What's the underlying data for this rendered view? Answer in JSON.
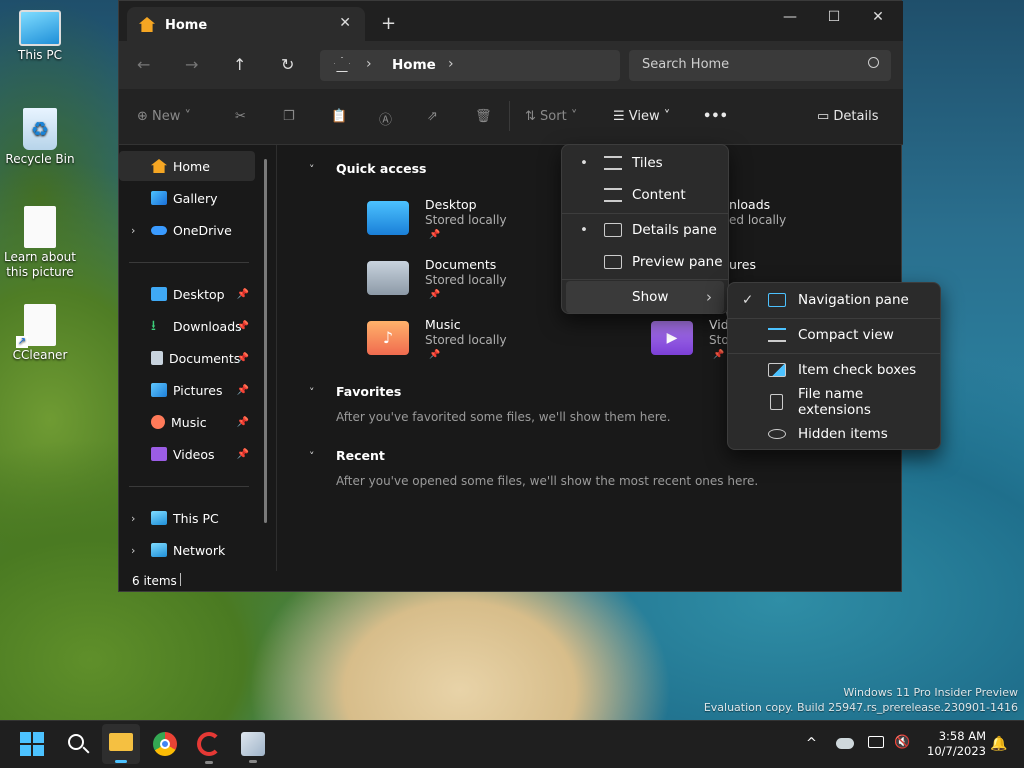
{
  "desktop": {
    "icons": [
      {
        "label": "This PC"
      },
      {
        "label": "Recycle Bin"
      },
      {
        "label": "Learn about this picture"
      },
      {
        "label": "CCleaner"
      }
    ],
    "watermark_line1": "Windows 11 Pro Insider Preview",
    "watermark_line2": "Evaluation copy. Build 25947.rs_prerelease.230901-1416"
  },
  "window": {
    "tab_title": "Home",
    "new_tab_symbol": "+",
    "caption": {
      "minimize": "—",
      "maximize": "☐",
      "close": "✕"
    },
    "address": {
      "breadcrumb": "Home",
      "search_placeholder": "Search Home"
    },
    "toolbar": {
      "new_label": "New",
      "sort_label": "Sort",
      "view_label": "View",
      "more_label": "•••",
      "details_label": "Details"
    },
    "sidebar": {
      "top": [
        {
          "label": "Home",
          "icon": "home-icon"
        },
        {
          "label": "Gallery",
          "icon": "gallery-icon"
        },
        {
          "label": "OneDrive",
          "icon": "onedrive-icon"
        }
      ],
      "pinned": [
        {
          "label": "Desktop",
          "icon": "desktop-folder-icon"
        },
        {
          "label": "Downloads",
          "icon": "download-icon"
        },
        {
          "label": "Documents",
          "icon": "documents-icon"
        },
        {
          "label": "Pictures",
          "icon": "pictures-icon"
        },
        {
          "label": "Music",
          "icon": "music-icon"
        },
        {
          "label": "Videos",
          "icon": "videos-icon"
        }
      ],
      "bottom": [
        {
          "label": "This PC",
          "icon": "this-pc-icon"
        },
        {
          "label": "Network",
          "icon": "network-icon"
        }
      ]
    },
    "main": {
      "quick_access_title": "Quick access",
      "quick_access": [
        {
          "name": "Desktop",
          "sub": "Stored locally"
        },
        {
          "name": "Documents",
          "sub": "Stored locally"
        },
        {
          "name": "Music",
          "sub": "Stored locally"
        },
        {
          "name": "nloads",
          "sub": "ed locally"
        },
        {
          "name": "ures",
          "sub": ""
        },
        {
          "name": "Vid",
          "sub": "Sto"
        }
      ],
      "favorites_title": "Favorites",
      "favorites_empty": "After you've favorited some files, we'll show them here.",
      "recent_title": "Recent",
      "recent_empty": "After you've opened some files, we'll show the most recent ones here."
    },
    "status": {
      "items": "6 items"
    }
  },
  "view_menu": {
    "items": [
      {
        "label": "Tiles",
        "bullet": "•"
      },
      {
        "label": "Content",
        "bullet": ""
      },
      {
        "label": "Details pane",
        "bullet": "•"
      },
      {
        "label": "Preview pane",
        "bullet": ""
      },
      {
        "label": "Show",
        "submenu_arrow": "›"
      }
    ]
  },
  "show_submenu": {
    "items": [
      {
        "label": "Navigation pane",
        "check": "✓"
      },
      {
        "label": "Compact view",
        "check": ""
      },
      {
        "label": "Item check boxes",
        "check": ""
      },
      {
        "label": "File name extensions",
        "check": ""
      },
      {
        "label": "Hidden items",
        "check": ""
      }
    ]
  },
  "taskbar": {
    "time": "3:58 AM",
    "date": "10/7/2023",
    "tray_chevron": "^"
  },
  "colors": {
    "accent_blue": "#4cc2ff",
    "folder_yellow": "#f5c041",
    "window_bg": "#191919"
  }
}
